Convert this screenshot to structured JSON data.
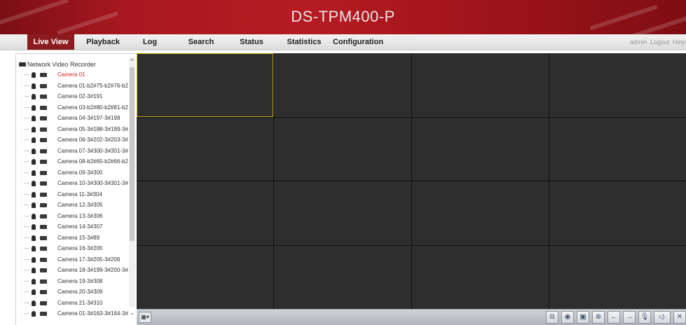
{
  "header": {
    "title": "DS-TPM400-P"
  },
  "nav": {
    "tabs": [
      {
        "label": "Live View",
        "active": true
      },
      {
        "label": "Playback"
      },
      {
        "label": "Log"
      },
      {
        "label": "Search"
      },
      {
        "label": "Status"
      },
      {
        "label": "Statistics"
      },
      {
        "label": "Configuration"
      }
    ],
    "user": "admin",
    "logout": "Logout",
    "help": "Help"
  },
  "sidebar": {
    "root_label": "Network Video Recorder",
    "cameras": [
      "Camera 01",
      "Camera 01-b2#75-b2#76-b2...",
      "Camera 02-3#191",
      "Camera 03-b2#80-b2#81-b2...",
      "Camera 04-3#197-3#198",
      "Camera 05-3#188-3#189-3#...",
      "Camera 06-3#202-3#203-3#...",
      "Camera 07-3#300-3#301-3#...",
      "Camera 08-b2#65-b2#66-b2...",
      "Camera 09-3#300",
      "Camera 10-3#300-3#301-3#...",
      "Camera 11-3#304",
      "Camera 12-3#305",
      "Camera 13-3#306",
      "Camera 14-3#307",
      "Camera 15-3#89",
      "Camera 16-3#205",
      "Camera 17-3#205-3#206",
      "Camera 18-3#199-3#200-3#...",
      "Camera 19-3#308",
      "Camera 20-3#309",
      "Camera 21-3#310",
      "Camera 01-3#163-3#164-3#..."
    ],
    "selected_index": 0
  },
  "grid": {
    "rows": 4,
    "cols": 4,
    "selected_cell": 0
  },
  "toolbar": {
    "buttons": [
      "stop-all-preview-icon",
      "capture-icon",
      "record-icon",
      "digital-zoom-icon",
      "previous-page-icon",
      "next-page-icon",
      "microphone-icon",
      "volume-icon",
      "close-icon"
    ]
  },
  "colors": {
    "brand_red": "#a81820",
    "active_tab": "#8b1b1e",
    "selected_camera": "#e02020",
    "selected_cell_border": "#c9a81b"
  }
}
